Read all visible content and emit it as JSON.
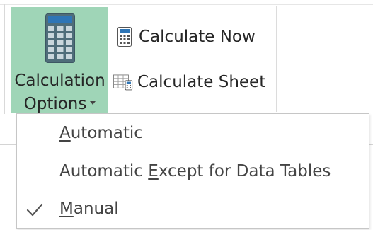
{
  "ribbon": {
    "calculation_options": {
      "label_line1": "Calculation",
      "label_line2": "Options",
      "icon": "calculator-large-icon",
      "state": "pressed"
    },
    "calculate_now": {
      "label": "Calculate Now",
      "icon": "calculator-icon"
    },
    "calculate_sheet": {
      "label": "Calculate Sheet",
      "icon": "sheet-calculator-icon"
    }
  },
  "menu": {
    "items": [
      {
        "label_pre": "",
        "mnemonic": "A",
        "label_post": "utomatic",
        "checked": false
      },
      {
        "label_pre": "Automatic ",
        "mnemonic": "E",
        "label_post": "xcept for Data Tables",
        "checked": false
      },
      {
        "label_pre": "",
        "mnemonic": "M",
        "label_post": "anual",
        "checked": true,
        "check_icon": "checkmark-icon"
      }
    ]
  },
  "colors": {
    "pressed_button_bg": "#9fd5b7",
    "calculator_body": "#4f6d7a",
    "calculator_screen": "#2e75b6",
    "text": "#262626",
    "menu_text": "#444444"
  }
}
